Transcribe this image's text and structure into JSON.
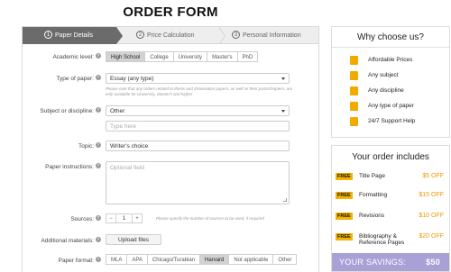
{
  "title": "ORDER FORM",
  "steps": [
    {
      "num": "1",
      "label": "Paper Details"
    },
    {
      "num": "2",
      "label": "Price Calculation"
    },
    {
      "num": "3",
      "label": "Personal Information"
    }
  ],
  "form": {
    "academic_level": {
      "label": "Academic level:",
      "options": [
        "High School",
        "College",
        "University",
        "Master's",
        "PhD"
      ],
      "selected": "High School"
    },
    "paper_type": {
      "label": "Type of paper:",
      "value": "Essay (any type)",
      "note": "Please note that any orders related to thesis and dissertation papers, as well as their parts/chapters, are only available for University, Master's and higher"
    },
    "subject": {
      "label": "Subject or discipline:",
      "value": "Other",
      "placeholder": "Type here"
    },
    "topic": {
      "label": "Topic:",
      "value": "Writer's choice"
    },
    "instructions": {
      "label": "Paper instructions:",
      "placeholder": "Optional field"
    },
    "sources": {
      "label": "Sources:",
      "minus": "−",
      "value": "1",
      "plus": "+",
      "note": "Please specify the number of sources to be used, if required"
    },
    "materials": {
      "label": "Additional materials:",
      "button": "Upload files"
    },
    "format": {
      "label": "Paper format:",
      "options": [
        "MLA",
        "APA",
        "Chicago/Turabian",
        "Harvard",
        "Not applicable",
        "Other"
      ],
      "selected": "Harvard"
    }
  },
  "why": {
    "title": "Why choose us?",
    "items": [
      {
        "icon": "price-tag-icon",
        "label": "Affordable Prices"
      },
      {
        "icon": "book-icon",
        "label": "Any subject"
      },
      {
        "icon": "books-icon",
        "label": "Any discipline"
      },
      {
        "icon": "document-icon",
        "label": "Any type of paper"
      },
      {
        "icon": "support-person-icon",
        "label": "24/7 Support Help"
      }
    ]
  },
  "includes": {
    "title": "Your order includes",
    "free_badge": "FREE",
    "items": [
      {
        "label": "Title Page",
        "off": "$5 OFF"
      },
      {
        "label": "Formatting",
        "off": "$15 OFF"
      },
      {
        "label": "Revisions",
        "off": "$10 OFF"
      },
      {
        "label": "Bibliography & Reference Pages",
        "off": "$20 OFF"
      }
    ],
    "savings_label": "YOUR SAVINGS:",
    "savings_value": "$50"
  },
  "colors": {
    "accent": "#f2b400",
    "savings_bg": "#a9a0d6",
    "step_active": "#6b6b6b"
  }
}
